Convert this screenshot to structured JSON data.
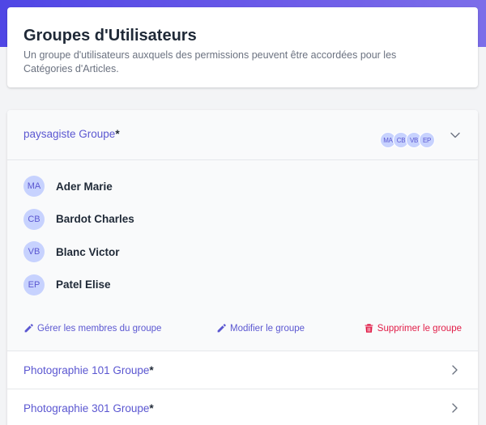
{
  "header": {
    "title": "Groupes d'Utilisateurs",
    "subtitle": "Un groupe d'utilisateurs auxquels des permissions peuvent être accordées pour les Catégories d'Articles."
  },
  "colors": {
    "accent": "#5b57d1",
    "danger": "#e11d48",
    "avatar_bg": "#c7d2fe",
    "banner": "#4f46e5"
  },
  "groups": [
    {
      "name": "paysagiste Groupe",
      "marker": "*",
      "expanded": true,
      "avatars": [
        "MA",
        "CB",
        "VB",
        "EP"
      ],
      "members": [
        {
          "initials": "MA",
          "name": "Ader Marie"
        },
        {
          "initials": "CB",
          "name": "Bardot Charles"
        },
        {
          "initials": "VB",
          "name": "Blanc Victor"
        },
        {
          "initials": "EP",
          "name": "Patel Elise"
        }
      ],
      "actions": {
        "manage": "Gérer les membres du groupe",
        "edit": "Modifier le groupe",
        "delete": "Supprimer le groupe"
      }
    },
    {
      "name": "Photographie 101 Groupe",
      "marker": "*",
      "expanded": false
    },
    {
      "name": "Photographie 301 Groupe",
      "marker": "*",
      "expanded": false
    }
  ],
  "icons": {
    "collapse": "chevron-down-icon",
    "expand": "chevron-right-icon",
    "manage": "pencil-icon",
    "edit": "pencil-icon",
    "delete": "trash-icon"
  }
}
